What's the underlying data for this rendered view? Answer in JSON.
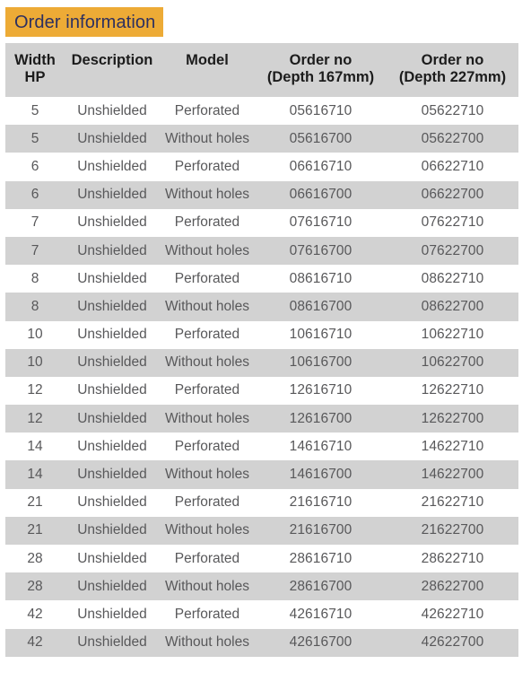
{
  "title": {
    "label": "Order information",
    "banner_color": "#edab36",
    "text_color": "#2d3060"
  },
  "table": {
    "header_background": "#d2d2d2",
    "stripe_background": "#d2d2d2",
    "row_background": "#ffffff",
    "text_color": "#58585a",
    "header_text_color": "#1c1c1c",
    "columns": [
      {
        "id": "width_hp",
        "line1": "Width",
        "line2": "HP"
      },
      {
        "id": "description",
        "line1": "Description",
        "line2": ""
      },
      {
        "id": "model",
        "line1": "Model",
        "line2": ""
      },
      {
        "id": "order_no_167",
        "line1": "Order no",
        "line2": "(Depth 167mm)"
      },
      {
        "id": "order_no_227",
        "line1": "Order no",
        "line2": "(Depth 227mm)"
      }
    ],
    "rows": [
      {
        "width_hp": "5",
        "description": "Unshielded",
        "model": "Perforated",
        "order_no_167": "05616710",
        "order_no_227": "05622710"
      },
      {
        "width_hp": "5",
        "description": "Unshielded",
        "model": "Without holes",
        "order_no_167": "05616700",
        "order_no_227": "05622700"
      },
      {
        "width_hp": "6",
        "description": "Unshielded",
        "model": "Perforated",
        "order_no_167": "06616710",
        "order_no_227": "06622710"
      },
      {
        "width_hp": "6",
        "description": "Unshielded",
        "model": "Without holes",
        "order_no_167": "06616700",
        "order_no_227": "06622700"
      },
      {
        "width_hp": "7",
        "description": "Unshielded",
        "model": "Perforated",
        "order_no_167": "07616710",
        "order_no_227": "07622710"
      },
      {
        "width_hp": "7",
        "description": "Unshielded",
        "model": "Without holes",
        "order_no_167": "07616700",
        "order_no_227": "07622700"
      },
      {
        "width_hp": "8",
        "description": "Unshielded",
        "model": "Perforated",
        "order_no_167": "08616710",
        "order_no_227": "08622710"
      },
      {
        "width_hp": "8",
        "description": "Unshielded",
        "model": "Without holes",
        "order_no_167": "08616700",
        "order_no_227": "08622700"
      },
      {
        "width_hp": "10",
        "description": "Unshielded",
        "model": "Perforated",
        "order_no_167": "10616710",
        "order_no_227": "10622710"
      },
      {
        "width_hp": "10",
        "description": "Unshielded",
        "model": "Without holes",
        "order_no_167": "10616700",
        "order_no_227": "10622700"
      },
      {
        "width_hp": "12",
        "description": "Unshielded",
        "model": "Perforated",
        "order_no_167": "12616710",
        "order_no_227": "12622710"
      },
      {
        "width_hp": "12",
        "description": "Unshielded",
        "model": "Without holes",
        "order_no_167": "12616700",
        "order_no_227": "12622700"
      },
      {
        "width_hp": "14",
        "description": "Unshielded",
        "model": "Perforated",
        "order_no_167": "14616710",
        "order_no_227": "14622710"
      },
      {
        "width_hp": "14",
        "description": "Unshielded",
        "model": "Without holes",
        "order_no_167": "14616700",
        "order_no_227": "14622700"
      },
      {
        "width_hp": "21",
        "description": "Unshielded",
        "model": "Perforated",
        "order_no_167": "21616710",
        "order_no_227": "21622710"
      },
      {
        "width_hp": "21",
        "description": "Unshielded",
        "model": "Without holes",
        "order_no_167": "21616700",
        "order_no_227": "21622700"
      },
      {
        "width_hp": "28",
        "description": "Unshielded",
        "model": "Perforated",
        "order_no_167": "28616710",
        "order_no_227": "28622710"
      },
      {
        "width_hp": "28",
        "description": "Unshielded",
        "model": "Without holes",
        "order_no_167": "28616700",
        "order_no_227": "28622700"
      },
      {
        "width_hp": "42",
        "description": "Unshielded",
        "model": "Perforated",
        "order_no_167": "42616710",
        "order_no_227": "42622710"
      },
      {
        "width_hp": "42",
        "description": "Unshielded",
        "model": "Without holes",
        "order_no_167": "42616700",
        "order_no_227": "42622700"
      }
    ]
  }
}
